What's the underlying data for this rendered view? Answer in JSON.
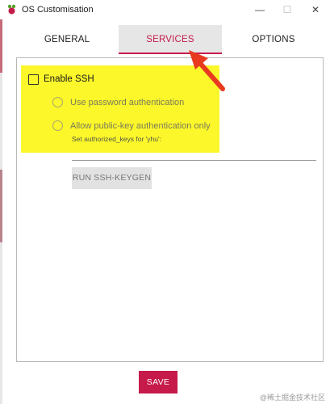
{
  "window": {
    "title": "OS Customisation",
    "icon": "raspberry-pi-icon",
    "controls": {
      "minimize": "—",
      "maximize": "☐",
      "close": "✕"
    }
  },
  "tabs": [
    {
      "label": "GENERAL",
      "selected": false
    },
    {
      "label": "SERVICES",
      "selected": true
    },
    {
      "label": "OPTIONS",
      "selected": false
    }
  ],
  "services": {
    "enable_ssh": {
      "label": "Enable SSH",
      "checked": false
    },
    "auth_options": [
      {
        "label": "Use password authentication",
        "selected": false
      },
      {
        "label": "Allow public-key authentication only",
        "selected": false
      }
    ],
    "authorized_keys_note": "Set authorized_keys for 'yhu':",
    "keygen_button": "RUN SSH-KEYGEN"
  },
  "save_button": "SAVE",
  "watermark": "@稀土掘金技术社区",
  "colors": {
    "accent": "#c51a4a",
    "highlight": "#fbf72a",
    "annotation_arrow": "#e83a1f"
  }
}
